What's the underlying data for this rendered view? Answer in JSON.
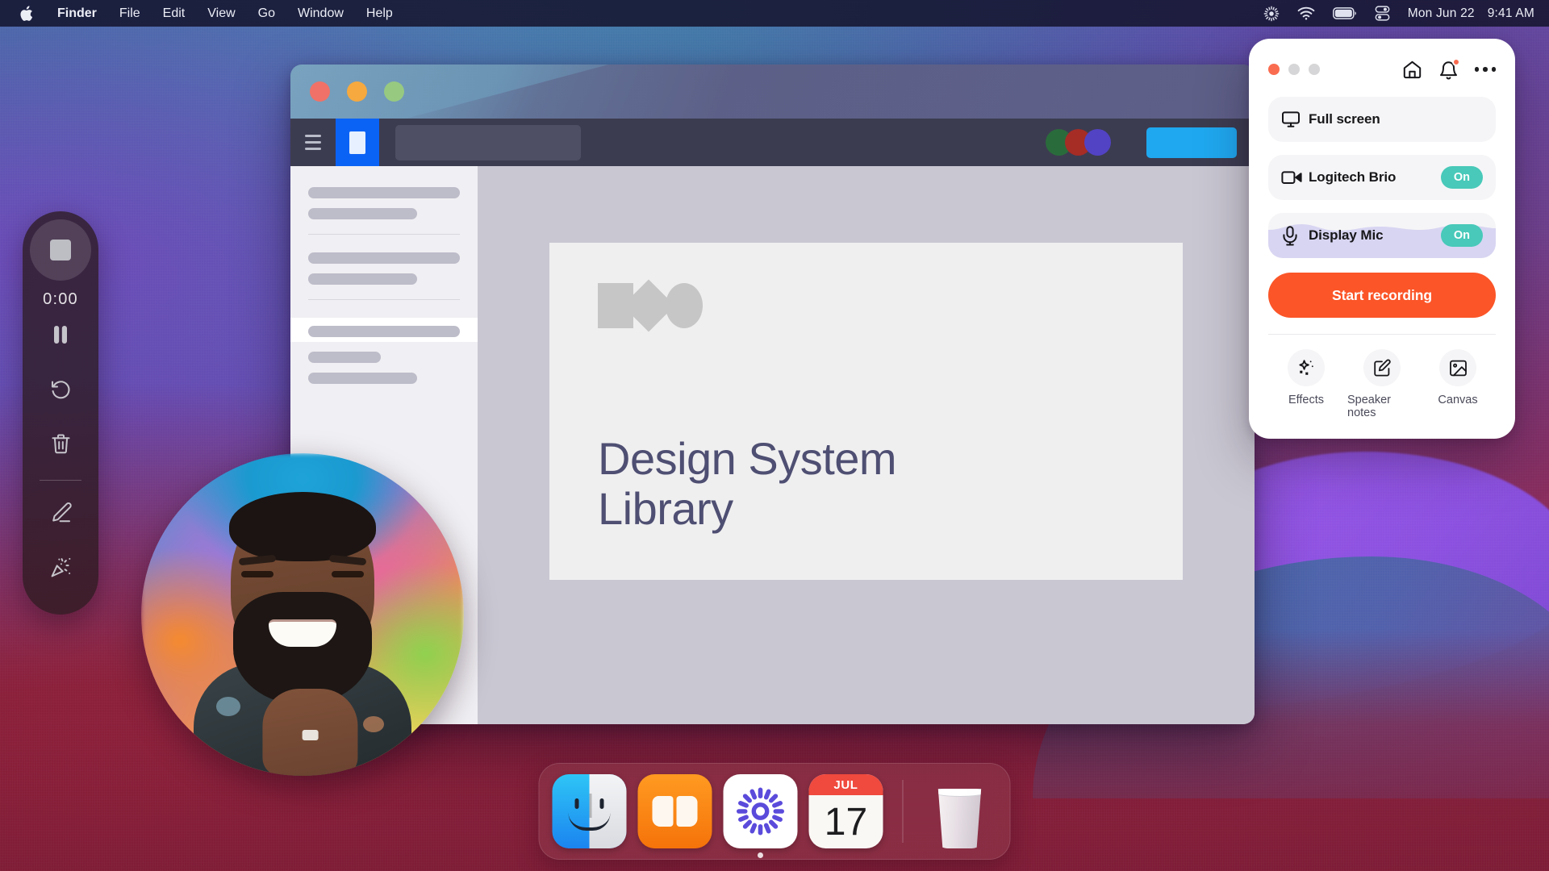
{
  "menubar": {
    "apple_icon": "apple-logo-icon",
    "items": [
      {
        "label": "Finder",
        "bold": true
      },
      {
        "label": "File",
        "bold": false
      },
      {
        "label": "Edit",
        "bold": false
      },
      {
        "label": "View",
        "bold": false
      },
      {
        "label": "Go",
        "bold": false
      },
      {
        "label": "Window",
        "bold": false
      },
      {
        "label": "Help",
        "bold": false
      }
    ],
    "status_icons": [
      "brightness-icon",
      "wifi-icon",
      "battery-icon",
      "control-center-icon"
    ],
    "date": "Mon Jun 22",
    "time": "9:41 AM"
  },
  "app_window": {
    "traffic_lights": [
      "close",
      "minimize",
      "zoom"
    ],
    "toolbar": {
      "menu_icon": "hamburger-menu-icon",
      "logo_icon": "app-logo-icon",
      "address_placeholder": "",
      "avatars": [
        "#2a6b3c",
        "#a62c26",
        "#5243c4"
      ],
      "cta_color": "#1fa8f0"
    },
    "slide": {
      "title_line1": "Design System",
      "title_line2": "Library",
      "shapes": [
        "square-shape",
        "diamond-shape",
        "circle-shape"
      ],
      "title_color": "#4e4f72"
    }
  },
  "recorder_toolbar": {
    "stop_label": "stop-recording-button",
    "timer": "0:00",
    "buttons": [
      {
        "name": "pause-button",
        "icon": "pause-icon"
      },
      {
        "name": "restart-button",
        "icon": "restart-arrow-icon"
      },
      {
        "name": "delete-button",
        "icon": "trash-icon"
      },
      {
        "name": "draw-button",
        "icon": "pen-icon"
      },
      {
        "name": "effects-button",
        "icon": "confetti-icon"
      }
    ]
  },
  "recorder_panel": {
    "traffic_lights": [
      "close",
      "minimize",
      "zoom"
    ],
    "header_icons": [
      {
        "name": "home-icon",
        "badge": false
      },
      {
        "name": "notification-bell-icon",
        "badge": true
      },
      {
        "name": "more-options-icon",
        "badge": false
      }
    ],
    "rows": [
      {
        "name": "full-screen-row",
        "icon": "monitor-icon",
        "label": "Full screen",
        "toggle": null
      },
      {
        "name": "camera-row",
        "icon": "video-camera-icon",
        "label": "Logitech Brio",
        "toggle": "On"
      },
      {
        "name": "microphone-row",
        "icon": "microphone-icon",
        "label": "Display Mic",
        "toggle": "On",
        "waveform": true
      }
    ],
    "record_button": "Start recording",
    "record_button_color": "#fb5528",
    "toggle_color": "#48c9b9",
    "tools": [
      {
        "name": "effects-tool",
        "icon": "sparkles-icon",
        "label": "Effects"
      },
      {
        "name": "speaker-notes-tool",
        "icon": "note-edit-icon",
        "label": "Speaker notes"
      },
      {
        "name": "canvas-tool",
        "icon": "image-icon",
        "label": "Canvas"
      }
    ]
  },
  "dock": {
    "items": [
      {
        "name": "dock-item-finder",
        "label": "Finder",
        "running": false
      },
      {
        "name": "dock-item-books",
        "label": "Books",
        "running": false
      },
      {
        "name": "dock-item-recorder",
        "label": "Screen Recorder",
        "running": true
      },
      {
        "name": "dock-item-calendar",
        "label": "Calendar",
        "month": "JUL",
        "day": "17",
        "running": false
      }
    ],
    "trash": {
      "name": "dock-item-trash",
      "label": "Trash"
    }
  }
}
